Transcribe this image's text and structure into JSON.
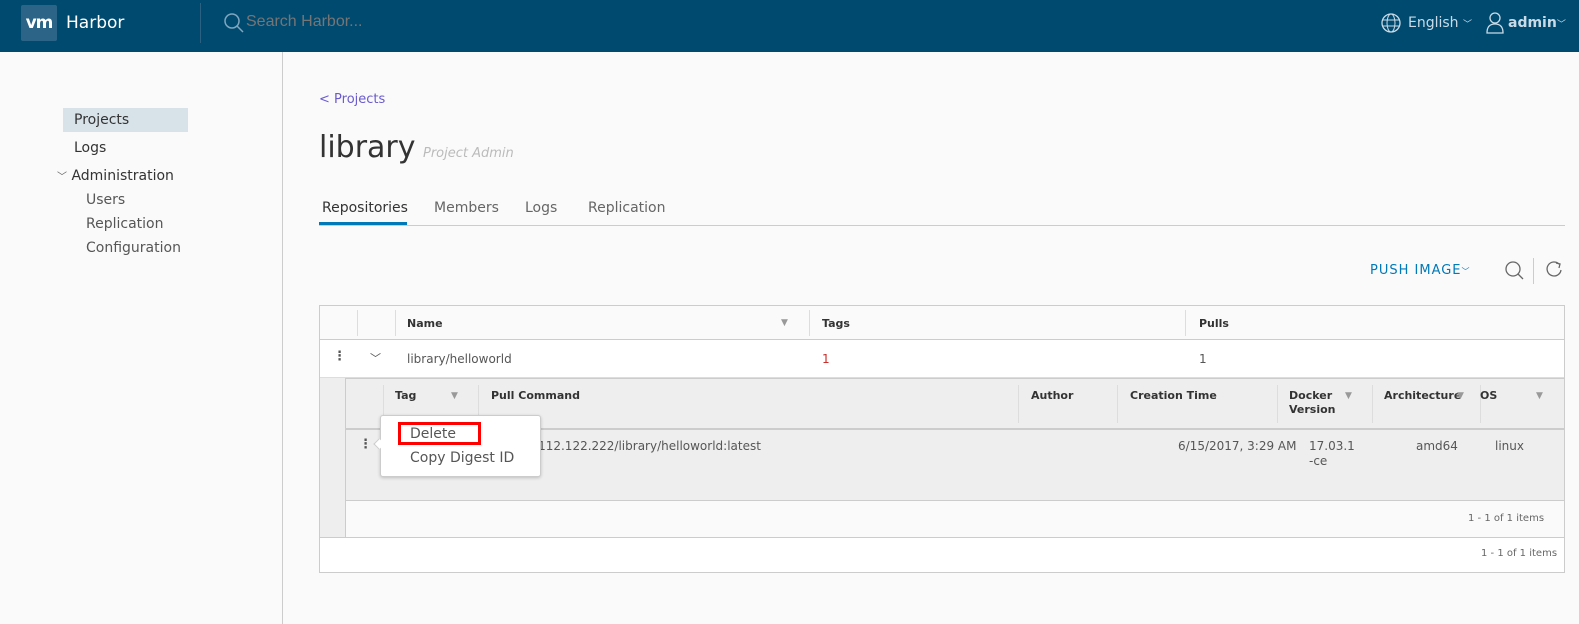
{
  "header": {
    "logo": "vm",
    "brand": "Harbor",
    "search_placeholder": "Search Harbor...",
    "language": "English",
    "user": "admin"
  },
  "sidebar": {
    "items": [
      {
        "label": "Projects",
        "selected": true
      },
      {
        "label": "Logs"
      },
      {
        "label": "Administration",
        "expanded": true,
        "children": [
          {
            "label": "Users"
          },
          {
            "label": "Replication"
          },
          {
            "label": "Configuration"
          }
        ]
      }
    ]
  },
  "main": {
    "back_link": "< Projects",
    "title": "library",
    "role": "Project Admin",
    "tabs": [
      {
        "label": "Repositories",
        "active": true
      },
      {
        "label": "Members"
      },
      {
        "label": "Logs"
      },
      {
        "label": "Replication"
      }
    ],
    "push_image": "PUSH IMAGE",
    "repo_table": {
      "columns": [
        "Name",
        "Tags",
        "Pulls"
      ],
      "rows": [
        {
          "name": "library/helloworld",
          "tags": "1",
          "pulls": "1"
        }
      ],
      "footer": "1 - 1 of 1 items"
    },
    "tag_table": {
      "columns": [
        "Tag",
        "Pull Command",
        "Author",
        "Creation Time",
        "Docker Version",
        "Architecture",
        "OS"
      ],
      "rows": [
        {
          "tag": "",
          "pull_command": "10.112.122.222/library/helloworld:latest",
          "author": "",
          "creation_time": "6/15/2017, 3:29 AM",
          "docker_version": "17.03.1-ce",
          "architecture": "amd64",
          "os": "linux"
        }
      ],
      "footer": "1 - 1 of 1 items"
    },
    "context_menu": {
      "items": [
        "Delete",
        "Copy Digest ID"
      ],
      "highlighted": "Delete",
      "highlight_color": "#ff0000"
    }
  },
  "colors": {
    "header": "#004a70",
    "accent": "#0079b8"
  }
}
